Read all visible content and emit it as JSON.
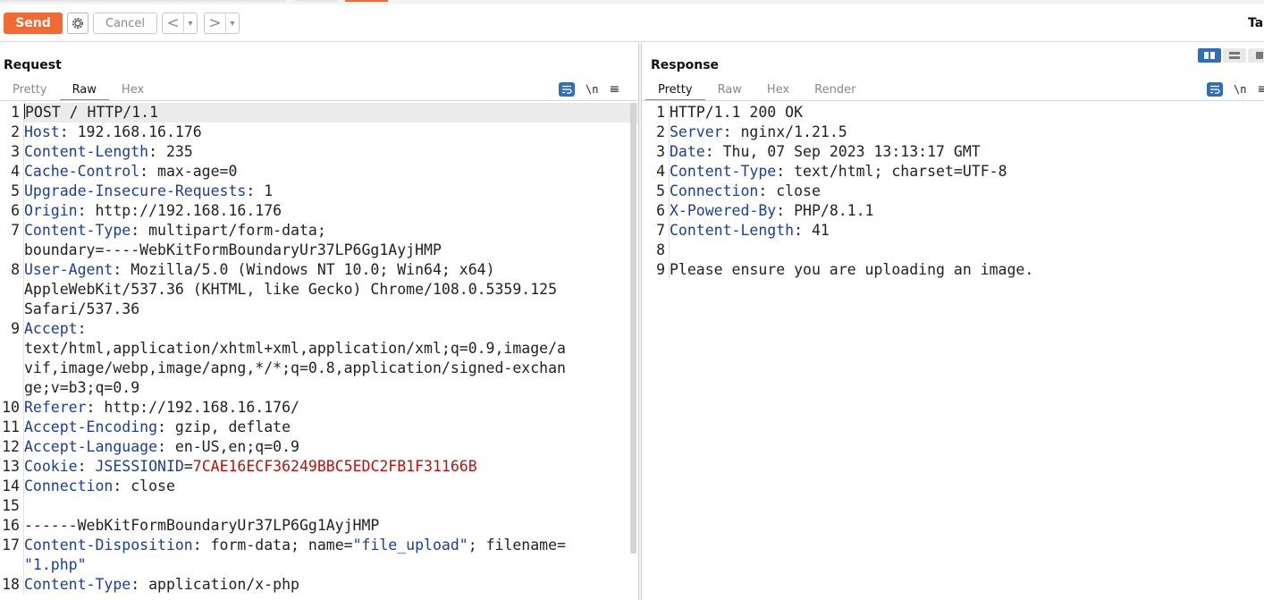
{
  "toolbar": {
    "send_label": "Send",
    "cancel_label": "Cancel",
    "prev_glyph": "<",
    "next_glyph": ">",
    "dropdown_glyph": "▾",
    "target_label": "Tar"
  },
  "request": {
    "title": "Request",
    "tabs": [
      "Pretty",
      "Raw",
      "Hex"
    ],
    "active_tab": "Raw",
    "newline_label": "\\n",
    "menu_glyph": "≡",
    "lines": [
      {
        "n": "1",
        "parts": [
          {
            "t": "POST / HTTP/1.1",
            "c": "plain"
          }
        ]
      },
      {
        "n": "2",
        "parts": [
          {
            "t": "Host",
            "c": "hn"
          },
          {
            "t": ": 192.168.16.176",
            "c": "hv"
          }
        ]
      },
      {
        "n": "3",
        "parts": [
          {
            "t": "Content-Length",
            "c": "hn"
          },
          {
            "t": ": 235",
            "c": "hv"
          }
        ]
      },
      {
        "n": "4",
        "parts": [
          {
            "t": "Cache-Control",
            "c": "hn"
          },
          {
            "t": ": max-age=0",
            "c": "hv"
          }
        ]
      },
      {
        "n": "5",
        "parts": [
          {
            "t": "Upgrade-Insecure-Requests",
            "c": "hn"
          },
          {
            "t": ": 1",
            "c": "hv"
          }
        ]
      },
      {
        "n": "6",
        "parts": [
          {
            "t": "Origin",
            "c": "hn"
          },
          {
            "t": ": http://192.168.16.176",
            "c": "hv"
          }
        ]
      },
      {
        "n": "7",
        "parts": [
          {
            "t": "Content-Type",
            "c": "hn"
          },
          {
            "t": ": multipart/form-data;\nboundary=----WebKitFormBoundaryUr37LP6Gg1AyjHMP",
            "c": "hv"
          }
        ]
      },
      {
        "n": "8",
        "parts": [
          {
            "t": "User-Agent",
            "c": "hn"
          },
          {
            "t": ": Mozilla/5.0 (Windows NT 10.0; Win64; x64)\nAppleWebKit/537.36 (KHTML, like Gecko) Chrome/108.0.5359.125\nSafari/537.36",
            "c": "hv"
          }
        ]
      },
      {
        "n": "9",
        "parts": [
          {
            "t": "Accept",
            "c": "hn"
          },
          {
            "t": ":\ntext/html,application/xhtml+xml,application/xml;q=0.9,image/a\nvif,image/webp,image/apng,*/*;q=0.8,application/signed-exchan\nge;v=b3;q=0.9",
            "c": "hv"
          }
        ]
      },
      {
        "n": "10",
        "parts": [
          {
            "t": "Referer",
            "c": "hn"
          },
          {
            "t": ": http://192.168.16.176/",
            "c": "hv"
          }
        ]
      },
      {
        "n": "11",
        "parts": [
          {
            "t": "Accept-Encoding",
            "c": "hn"
          },
          {
            "t": ": gzip, deflate",
            "c": "hv"
          }
        ]
      },
      {
        "n": "12",
        "parts": [
          {
            "t": "Accept-Language",
            "c": "hn"
          },
          {
            "t": ": en-US,en;q=0.9",
            "c": "hv"
          }
        ]
      },
      {
        "n": "13",
        "parts": [
          {
            "t": "Cookie",
            "c": "hn"
          },
          {
            "t": ": ",
            "c": "hv"
          },
          {
            "t": "JSESSIONID",
            "c": "cn"
          },
          {
            "t": "=",
            "c": "hv"
          },
          {
            "t": "7CAE16ECF36249BBC5EDC2FB1F31166B",
            "c": "cv"
          }
        ]
      },
      {
        "n": "14",
        "parts": [
          {
            "t": "Connection",
            "c": "hn"
          },
          {
            "t": ": close",
            "c": "hv"
          }
        ]
      },
      {
        "n": "15",
        "parts": [
          {
            "t": "",
            "c": "plain"
          }
        ]
      },
      {
        "n": "16",
        "parts": [
          {
            "t": "------WebKitFormBoundaryUr37LP6Gg1AyjHMP",
            "c": "plain"
          }
        ]
      },
      {
        "n": "17",
        "parts": [
          {
            "t": "Content-Disposition",
            "c": "hn"
          },
          {
            "t": ": form-data; name=",
            "c": "hv"
          },
          {
            "t": "\"file_upload\"",
            "c": "str"
          },
          {
            "t": "; filename=\n",
            "c": "hv"
          },
          {
            "t": "\"1.php\"",
            "c": "str"
          }
        ]
      },
      {
        "n": "18",
        "parts": [
          {
            "t": "Content-Type",
            "c": "hn"
          },
          {
            "t": ": application/x-php",
            "c": "hv"
          }
        ]
      }
    ]
  },
  "response": {
    "title": "Response",
    "tabs": [
      "Pretty",
      "Raw",
      "Hex",
      "Render"
    ],
    "active_tab": "Pretty",
    "newline_label": "\\n",
    "menu_glyph": "≡",
    "lines": [
      {
        "n": "1",
        "parts": [
          {
            "t": "HTTP/1.1 200 OK",
            "c": "plain"
          }
        ]
      },
      {
        "n": "2",
        "parts": [
          {
            "t": "Server",
            "c": "hn"
          },
          {
            "t": ": nginx/1.21.5",
            "c": "hv"
          }
        ]
      },
      {
        "n": "3",
        "parts": [
          {
            "t": "Date",
            "c": "hn"
          },
          {
            "t": ": Thu, 07 Sep 2023 13:13:17 GMT",
            "c": "hv"
          }
        ]
      },
      {
        "n": "4",
        "parts": [
          {
            "t": "Content-Type",
            "c": "hn"
          },
          {
            "t": ": text/html; charset=UTF-8",
            "c": "hv"
          }
        ]
      },
      {
        "n": "5",
        "parts": [
          {
            "t": "Connection",
            "c": "hn"
          },
          {
            "t": ": close",
            "c": "hv"
          }
        ]
      },
      {
        "n": "6",
        "parts": [
          {
            "t": "X-Powered-By",
            "c": "hn"
          },
          {
            "t": ": PHP/8.1.1",
            "c": "hv"
          }
        ]
      },
      {
        "n": "7",
        "parts": [
          {
            "t": "Content-Length",
            "c": "hn"
          },
          {
            "t": ": 41",
            "c": "hv"
          }
        ]
      },
      {
        "n": "8",
        "parts": [
          {
            "t": "",
            "c": "plain"
          }
        ]
      },
      {
        "n": "9",
        "parts": [
          {
            "t": "Please ensure you are uploading an image.",
            "c": "plain"
          }
        ]
      }
    ]
  },
  "colors": {
    "accent": "#f26a31",
    "header_name": "#1e3f8e",
    "cookie_value": "#b3140f",
    "toggle_blue": "#2f6fb5"
  }
}
